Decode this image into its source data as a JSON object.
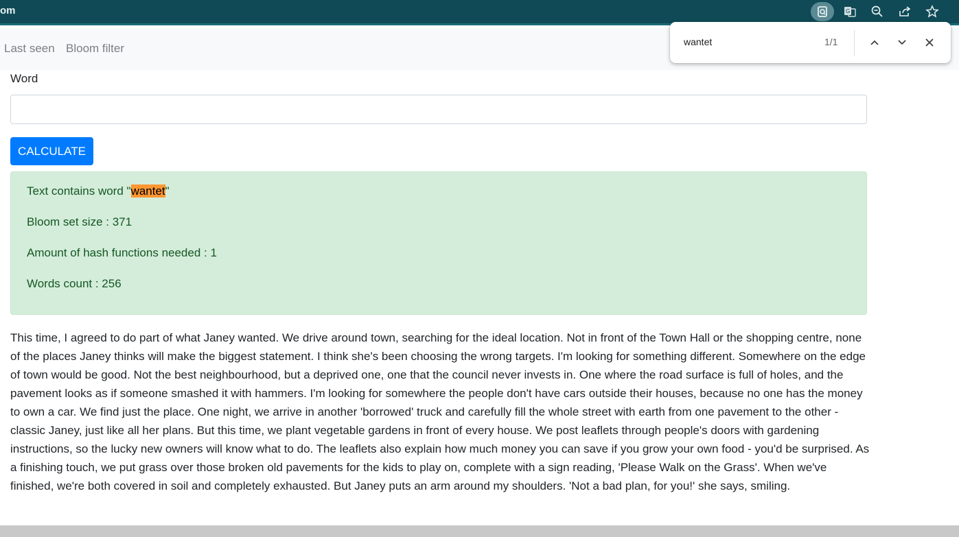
{
  "browser": {
    "url_fragment": "om",
    "icons": [
      "find-in-page-icon",
      "translate-icon",
      "zoom-out-icon",
      "share-icon",
      "bookmark-star-icon"
    ]
  },
  "nav": {
    "items": [
      {
        "label": "Last seen"
      },
      {
        "label": "Bloom filter"
      }
    ]
  },
  "find_bar": {
    "query": "wantet",
    "count": "1/1"
  },
  "form": {
    "word_label": "Word",
    "word_value": "",
    "calculate_label": "CALCULATE"
  },
  "result": {
    "contains_prefix": "Text contains word \"",
    "contains_word": "wantet",
    "contains_suffix": "\"",
    "bloom_size": "Bloom set size : 371",
    "hash_functions": "Amount of hash functions needed : 1",
    "words_count": "Words count : 256"
  },
  "text": "This time, I agreed to do part of what Janey wanted. We drive around town, searching for the ideal location. Not in front of the Town Hall or the shopping centre, none of the places Janey thinks will make the biggest statement. I think she's been choosing the wrong targets. I'm looking for something different. Somewhere on the edge of town would be good. Not the best neighbourhood, but a deprived one, one that the council never invests in. One where the road surface is full of holes, and the pavement looks as if someone smashed it with hammers. I'm looking for somewhere the people don't have cars outside their houses, because no one has the money to own a car. We find just the place. One night, we arrive in another 'borrowed' truck and carefully fill the whole street with earth from one pavement to the other - classic Janey, just like all her plans. But this time, we plant vegetable gardens in front of every house. We post leaflets through people's doors with gardening instructions, so the lucky new owners will know what to do. The leaflets also explain how much money you can save if you grow your own food - you'd be surprised. As a finishing touch, we put grass over those broken old pavements for the kids to play on, complete with a sign reading, 'Please Walk on the Grass'. When we've finished, we're both covered in soil and completely exhausted. But Janey puts an arm around my shoulders. 'Not a bad plan, for you!' she says, smiling."
}
